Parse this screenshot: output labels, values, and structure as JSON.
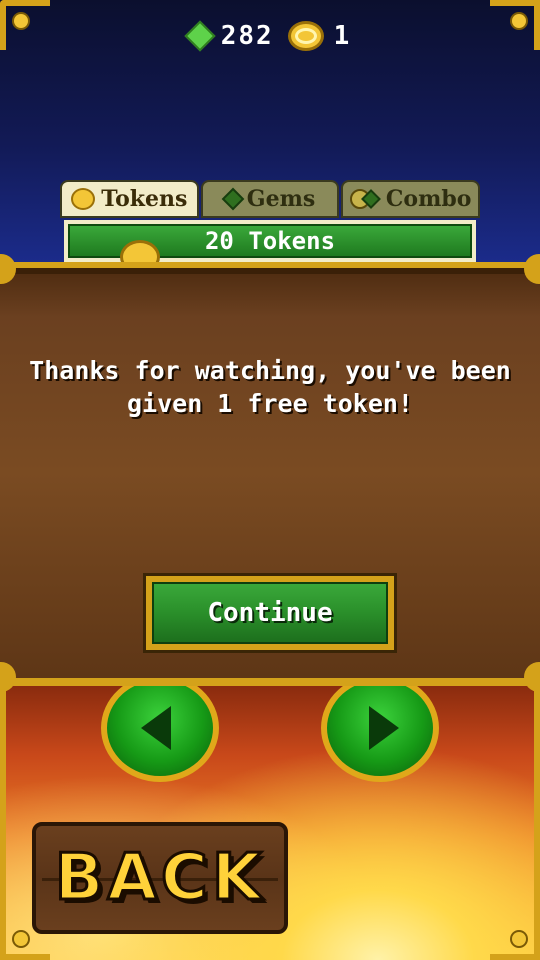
{
  "currency": {
    "gems": "282",
    "tokens": "1"
  },
  "tabs": [
    {
      "label": "Tokens",
      "icon": "coin-icon",
      "active": true
    },
    {
      "label": "Gems",
      "icon": "gem-icon",
      "active": false
    },
    {
      "label": "Combo",
      "icon": "combo-icon",
      "active": false
    }
  ],
  "offer": {
    "label": "20 Tokens"
  },
  "dialog": {
    "message": "Thanks for watching, you've been given 1 free token!",
    "continue_label": "Continue"
  },
  "nav": {
    "back_label": "BACK"
  },
  "colors": {
    "gold": "#d4a21a",
    "green": "#2a8f2a",
    "panel": "#7a4b22"
  }
}
